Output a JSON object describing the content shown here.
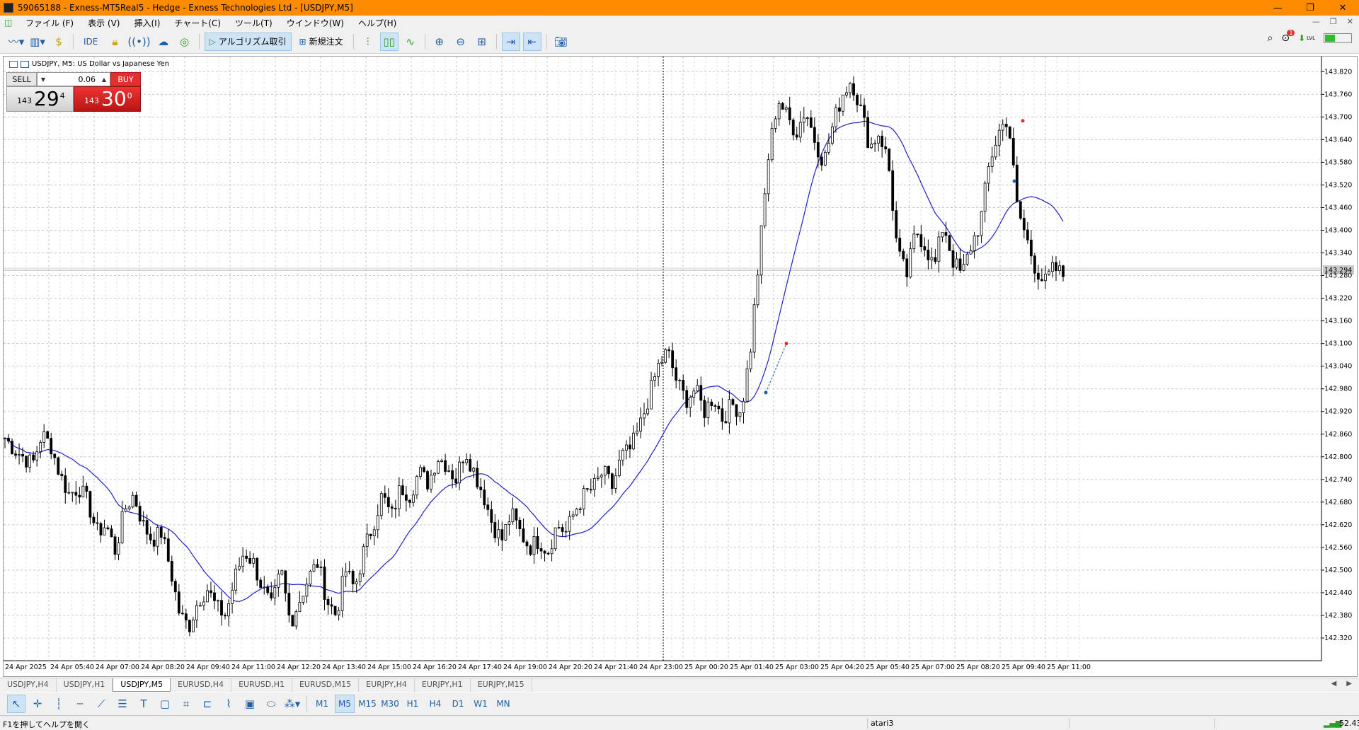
{
  "window": {
    "title": "59065188 - Exness-MT5Real5 - Hedge - Exness Technologies Ltd - [USDJPY,M5]",
    "controls": [
      "—",
      "❐",
      "✕"
    ],
    "mdi_controls": [
      "—",
      "❐",
      "✕"
    ]
  },
  "menu": {
    "items": [
      "ファイル (F)",
      "表示 (V)",
      "挿入(I)",
      "チャート(C)",
      "ツール(T)",
      "ウインドウ(W)",
      "ヘルプ(H)"
    ]
  },
  "toolbar": {
    "ide_label": "IDE",
    "algo_label": "アルゴリズム取引",
    "new_order_label": "新規注文",
    "notification_count": "1",
    "signal_label": "LVL"
  },
  "chart": {
    "header": "USDJPY, M5:  US Dollar vs Japanese Yen",
    "trade": {
      "sell_label": "SELL",
      "buy_label": "BUY",
      "lot": "0.06",
      "sell_prefix": "143",
      "sell_big": "29",
      "sell_sup": "4",
      "buy_prefix": "143",
      "buy_big": "30",
      "buy_sup": "0"
    },
    "current_price_label": "143.294"
  },
  "chart_data": {
    "type": "candlestick",
    "symbol": "USDJPY",
    "timeframe": "M5",
    "ylim": [
      142.26,
      143.86
    ],
    "y_ticks": [
      "143.820",
      "143.760",
      "143.700",
      "143.640",
      "143.580",
      "143.520",
      "143.460",
      "143.400",
      "143.340",
      "143.280",
      "143.220",
      "143.160",
      "143.100",
      "143.040",
      "142.980",
      "142.920",
      "142.860",
      "142.800",
      "142.740",
      "142.680",
      "142.620",
      "142.560",
      "142.500",
      "142.440",
      "142.380",
      "142.320"
    ],
    "x_ticks": [
      "24 Apr 2025",
      "24 Apr 05:40",
      "24 Apr 07:00",
      "24 Apr 08:20",
      "24 Apr 09:40",
      "24 Apr 11:00",
      "24 Apr 12:20",
      "24 Apr 13:40",
      "24 Apr 15:00",
      "24 Apr 16:20",
      "24 Apr 17:40",
      "24 Apr 19:00",
      "24 Apr 20:20",
      "24 Apr 21:40",
      "24 Apr 23:00",
      "25 Apr 00:20",
      "25 Apr 01:40",
      "25 Apr 03:00",
      "25 Apr 04:20",
      "25 Apr 05:40",
      "25 Apr 07:00",
      "25 Apr 08:20",
      "25 Apr 09:40",
      "25 Apr 11:00"
    ],
    "close_path": [
      142.85,
      142.82,
      142.8,
      142.78,
      142.86,
      142.83,
      142.75,
      142.7,
      142.72,
      142.68,
      142.6,
      142.62,
      142.55,
      142.66,
      142.7,
      142.62,
      142.58,
      142.6,
      142.5,
      142.38,
      142.35,
      142.42,
      142.45,
      142.4,
      142.38,
      142.48,
      142.55,
      142.52,
      142.45,
      142.4,
      142.5,
      142.36,
      142.42,
      142.48,
      142.52,
      142.42,
      142.38,
      142.5,
      142.45,
      142.55,
      142.62,
      142.7,
      142.64,
      142.72,
      142.7,
      142.76,
      142.73,
      142.8,
      142.78,
      142.74,
      142.82,
      142.76,
      142.7,
      142.62,
      142.58,
      142.65,
      142.6,
      142.56,
      142.58,
      142.55,
      142.62,
      142.6,
      142.66,
      142.7,
      142.72,
      142.76,
      142.72,
      142.8,
      142.82,
      142.88,
      142.96,
      143.04,
      143.08,
      143.0,
      142.95,
      142.98,
      142.92,
      142.96,
      142.9,
      142.94,
      142.92,
      143.08,
      143.34,
      143.6,
      143.75,
      143.7,
      143.66,
      143.72,
      143.64,
      143.58,
      143.68,
      143.76,
      143.8,
      143.72,
      143.62,
      143.66,
      143.58,
      143.34,
      143.28,
      143.4,
      143.36,
      143.3,
      143.42,
      143.32,
      143.28,
      143.36,
      143.42,
      143.58,
      143.66,
      143.7,
      143.46,
      143.38,
      143.3,
      143.26,
      143.3,
      143.28
    ],
    "ma_period": 20,
    "ma_color": "#2020c0",
    "candle_color": "#000000",
    "grid": true,
    "current_price": 143.294,
    "vertical_marker_time": "24 Apr 23:00"
  },
  "tabs": {
    "items": [
      "USDJPY,H4",
      "USDJPY,H1",
      "USDJPY,M5",
      "EURUSD,H4",
      "EURUSD,H1",
      "EURUSD,M15",
      "EURJPY,H4",
      "EURJPY,H1",
      "EURJPY,M15"
    ],
    "active": "USDJPY,M5"
  },
  "timeframes": {
    "items": [
      "M1",
      "M5",
      "M15",
      "M30",
      "H1",
      "H4",
      "D1",
      "W1",
      "MN"
    ],
    "active": "M5"
  },
  "status": {
    "help": "F1を押してヘルプを開く",
    "profile": "atari3",
    "ping": "52.43"
  },
  "colors": {
    "titlebar": "#ff8c00",
    "buy": "#e03030",
    "ma_line": "#2020c0"
  }
}
